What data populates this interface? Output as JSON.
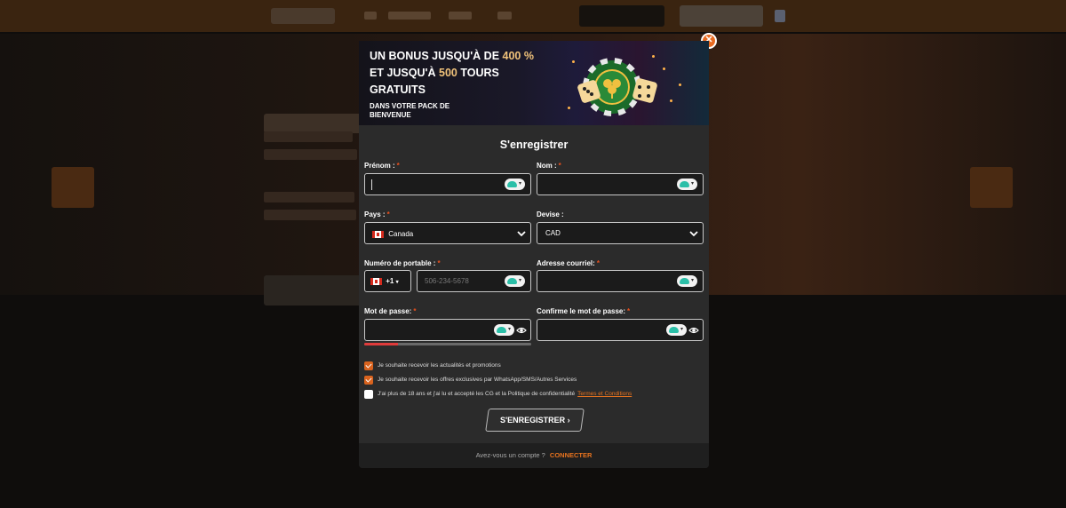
{
  "banner": {
    "line1_prefix": "UN BONUS JUSQU'À DE ",
    "line1_highlight": "400 %",
    "line2_prefix": "ET JUSQU'À ",
    "line2_highlight": "500",
    "line2_suffix": " TOURS",
    "line3": "GRATUITS",
    "sub": "DANS VOTRE PACK DE BIENVENUE"
  },
  "close_icon": "close-icon",
  "form": {
    "title": "S'enregistrer",
    "first_name": {
      "label": "Prénom :",
      "value": ""
    },
    "last_name": {
      "label": "Nom :",
      "value": ""
    },
    "country": {
      "label": "Pays :",
      "value": "Canada"
    },
    "currency": {
      "label": "Devise :",
      "value": "CAD"
    },
    "phone": {
      "label": "Numéro de portable :",
      "code": "+1",
      "placeholder": "506-234-5678"
    },
    "email": {
      "label": "Adresse courriel:",
      "value": ""
    },
    "password": {
      "label": "Mot de passe:",
      "strength": 0.2
    },
    "confirm_password": {
      "label": "Confirme le mot de passe:"
    },
    "required_mark": "*",
    "checkboxes": [
      {
        "label": "Je souhaite recevoir les actualités et promotions",
        "checked": true
      },
      {
        "label": "Je souhaite recevoir les offres exclusives par WhatsApp/SMS/Autres Services",
        "checked": true
      },
      {
        "label": "J'ai plus de 18 ans et j'ai lu et accepté les CG et la Politique de confidentialité",
        "link": "Termes et Conditions",
        "checked": false
      }
    ],
    "submit_label": "S'ENREGISTRER",
    "submit_arrow": "›"
  },
  "footer": {
    "question": "Avez-vous un compte ?",
    "login_label": "CONNECTER"
  },
  "colors": {
    "accent": "#e8731e",
    "required": "#e8501e",
    "modal_bg": "#2b2b2b",
    "field_bg": "#1b1b1b",
    "highlight": "#f0c27a"
  }
}
